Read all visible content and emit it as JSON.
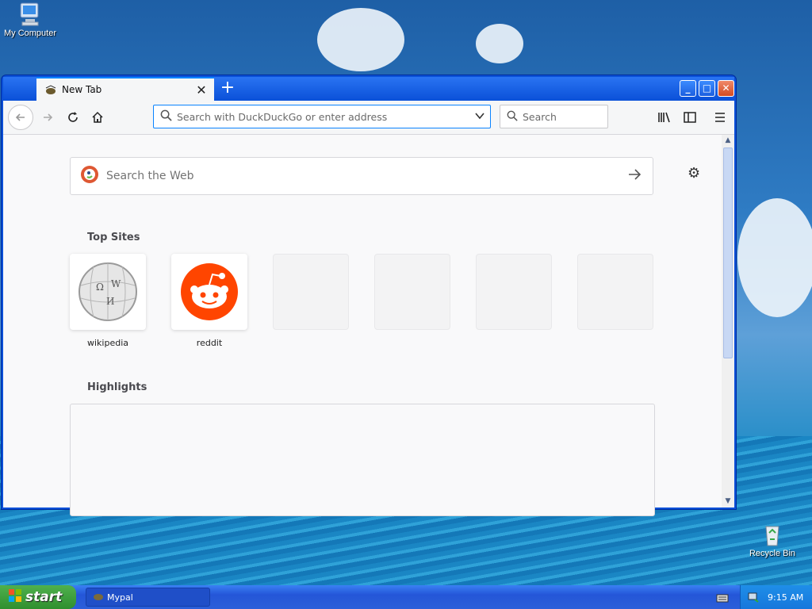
{
  "desktop": {
    "icons": [
      {
        "label": "My Computer"
      },
      {
        "label": "Recycle Bin"
      }
    ]
  },
  "browser": {
    "tab": {
      "title": "New Tab"
    },
    "urlbar": {
      "placeholder": "Search with DuckDuckGo or enter address"
    },
    "searchbar": {
      "placeholder": "Search"
    },
    "newtab": {
      "search_placeholder": "Search the Web",
      "top_sites_heading": "Top Sites",
      "top_sites": [
        {
          "label": "wikipedia",
          "icon": "wikipedia-globe-icon"
        },
        {
          "label": "reddit",
          "icon": "reddit-alien-icon",
          "color": "#ff4500"
        }
      ],
      "highlights_heading": "Highlights"
    }
  },
  "taskbar": {
    "start_label": "start",
    "task_label": "Mypal",
    "clock": "9:15 AM"
  },
  "colors": {
    "accent": "#0a84ff",
    "titlebar": "#0a50d8",
    "start_green": "#3a9e3a",
    "reddit": "#ff4500"
  }
}
